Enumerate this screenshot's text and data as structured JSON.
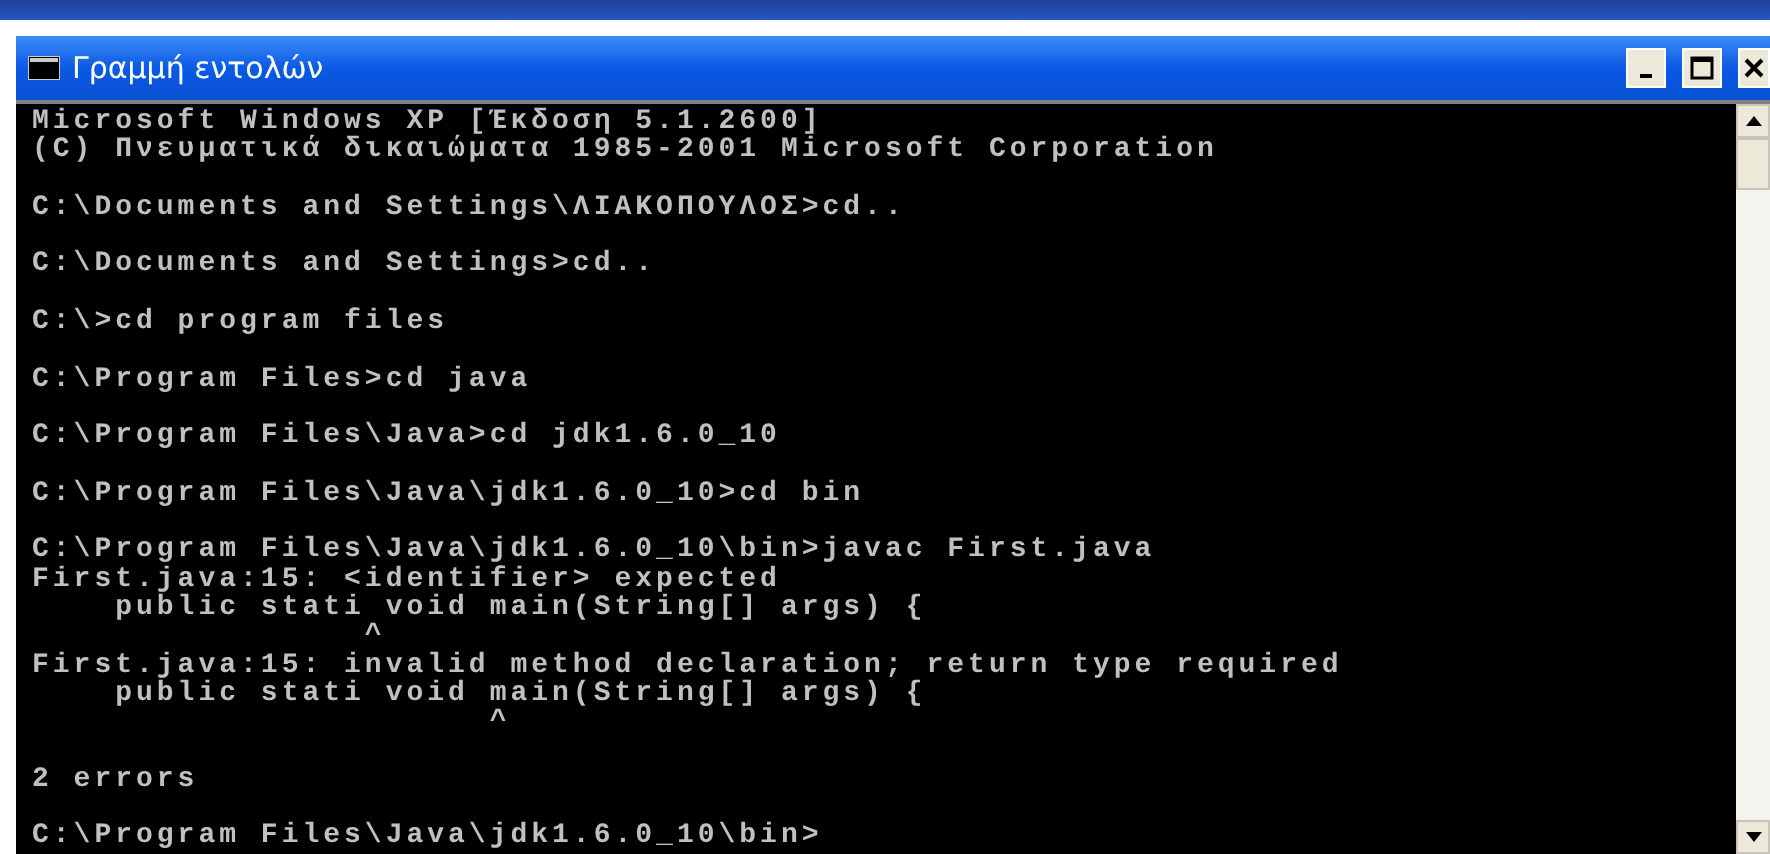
{
  "window": {
    "title": "Γραμμή εντολών"
  },
  "console": {
    "lines": [
      {
        "kind": "text",
        "text": "Microsoft Windows XP [Έκδοση 5.1.2600]"
      },
      {
        "kind": "text",
        "text": "(C) Πνευματικά δικαιώματα 1985-2001 Microsoft Corporation"
      },
      {
        "kind": "blank"
      },
      {
        "kind": "text",
        "text": "C:\\Documents and Settings\\ΛΙΑΚΟΠΟΥΛΟΣ>cd.."
      },
      {
        "kind": "blank"
      },
      {
        "kind": "text",
        "text": "C:\\Documents and Settings>cd.."
      },
      {
        "kind": "blank"
      },
      {
        "kind": "text",
        "text": "C:\\>cd program files"
      },
      {
        "kind": "blank"
      },
      {
        "kind": "text",
        "text": "C:\\Program Files>cd java"
      },
      {
        "kind": "blank"
      },
      {
        "kind": "text",
        "text": "C:\\Program Files\\Java>cd jdk1.6.0_10"
      },
      {
        "kind": "blank"
      },
      {
        "kind": "text",
        "text": "C:\\Program Files\\Java\\jdk1.6.0_10>cd bin"
      },
      {
        "kind": "blank"
      },
      {
        "kind": "text",
        "text": "C:\\Program Files\\Java\\jdk1.6.0_10\\bin>javac First.java"
      },
      {
        "kind": "text",
        "text": "First.java:15: <identifier> expected"
      },
      {
        "kind": "text",
        "text": "    public stati void main(String[] args) {"
      },
      {
        "kind": "text",
        "text": "                ^"
      },
      {
        "kind": "text",
        "text": "First.java:15: invalid method declaration; return type required"
      },
      {
        "kind": "text",
        "text": "    public stati void main(String[] args) {"
      },
      {
        "kind": "text",
        "text": "                      ^"
      },
      {
        "kind": "blank"
      },
      {
        "kind": "text",
        "text": "2 errors"
      },
      {
        "kind": "blank"
      },
      {
        "kind": "text",
        "text": "C:\\Program Files\\Java\\jdk1.6.0_10\\bin>"
      }
    ]
  }
}
